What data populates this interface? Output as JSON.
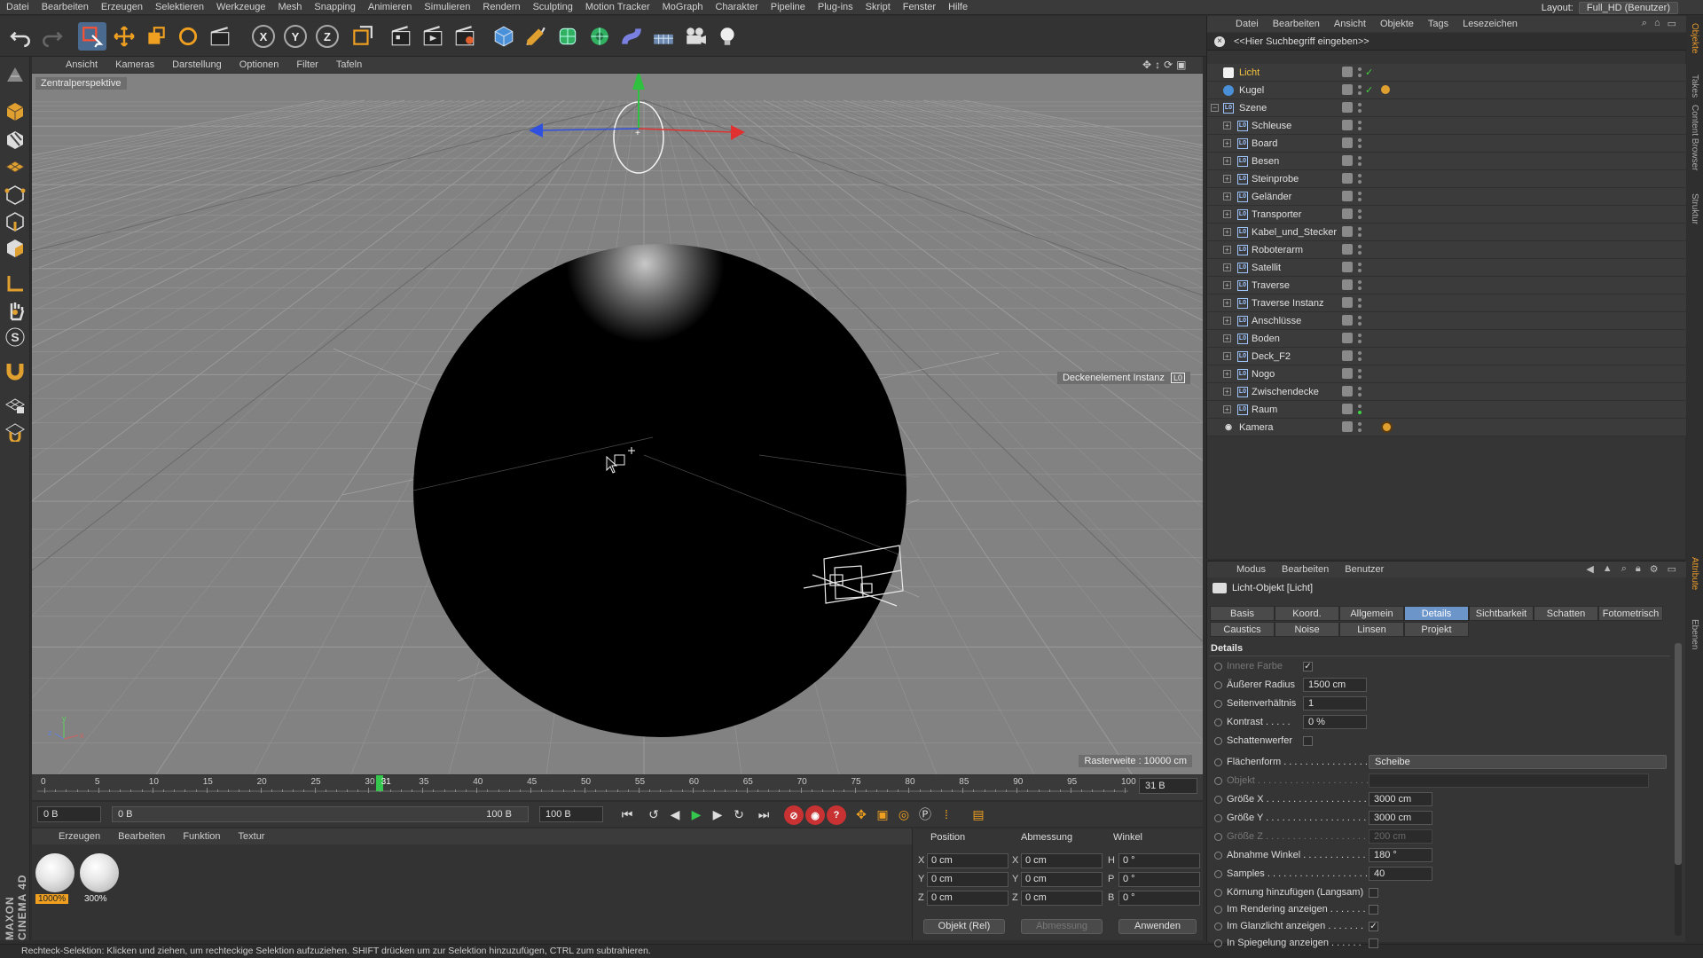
{
  "menubar": {
    "items": [
      "Datei",
      "Bearbeiten",
      "Erzeugen",
      "Selektieren",
      "Werkzeuge",
      "Mesh",
      "Snapping",
      "Animieren",
      "Simulieren",
      "Rendern",
      "Sculpting",
      "Motion Tracker",
      "MoGraph",
      "Charakter",
      "Pipeline",
      "Plug-ins",
      "Skript",
      "Fenster",
      "Hilfe"
    ],
    "layout_label": "Layout:",
    "layout_value": "Full_HD (Benutzer)"
  },
  "toolbar": {
    "axis_x": "X",
    "axis_y": "Y",
    "axis_z": "Z"
  },
  "viewport": {
    "menu": [
      "Ansicht",
      "Kameras",
      "Darstellung",
      "Optionen",
      "Filter",
      "Tafeln"
    ],
    "camera_label": "Zentralperspektive",
    "object_label": "Deckenelement Instanz",
    "grid_status": "Rasterweite : 10000 cm",
    "axis_x": "x",
    "axis_y": "y",
    "axis_z": "z"
  },
  "timeline": {
    "ticks": [
      "0",
      "5",
      "10",
      "15",
      "20",
      "25",
      "30",
      "31",
      "35",
      "40",
      "45",
      "50",
      "55",
      "60",
      "65",
      "70",
      "75",
      "80",
      "85",
      "90",
      "95",
      "100"
    ],
    "current_frame": 31,
    "end_field": "31 B"
  },
  "transport": {
    "start_field": "0 B",
    "range_start": "0 B",
    "range_end": "100 B",
    "end_field": "100 B"
  },
  "material_manager": {
    "menu": [
      "Erzeugen",
      "Bearbeiten",
      "Funktion",
      "Textur"
    ],
    "materials": [
      {
        "pct": "1000%"
      },
      {
        "pct": "300%"
      }
    ]
  },
  "coordinates": {
    "header_position": "Position",
    "header_size": "Abmessung",
    "header_angle": "Winkel",
    "rows": [
      {
        "axis": "X",
        "pos": "0 cm",
        "size_axis": "X",
        "size": "0 cm",
        "angle_axis": "H",
        "angle": "0 °"
      },
      {
        "axis": "Y",
        "pos": "0 cm",
        "size_axis": "Y",
        "size": "0 cm",
        "angle_axis": "P",
        "angle": "0 °"
      },
      {
        "axis": "Z",
        "pos": "0 cm",
        "size_axis": "Z",
        "size": "0 cm",
        "angle_axis": "B",
        "angle": "0 °"
      }
    ],
    "mode": "Objekt (Rel)",
    "size_mode": "Abmessung",
    "apply": "Anwenden"
  },
  "object_manager": {
    "menu": [
      "Datei",
      "Bearbeiten",
      "Ansicht",
      "Objekte",
      "Tags",
      "Lesezeichen"
    ],
    "search_placeholder": "<<Hier Suchbegriff eingeben>>",
    "objects": [
      {
        "name": "Licht",
        "type": "light",
        "selected": true
      },
      {
        "name": "Kugel",
        "type": "sphere"
      },
      {
        "name": "Szene",
        "type": "null"
      },
      {
        "name": "Schleuse",
        "type": "null",
        "child": true
      },
      {
        "name": "Board",
        "type": "null",
        "child": true
      },
      {
        "name": "Besen",
        "type": "null",
        "child": true
      },
      {
        "name": "Steinprobe",
        "type": "null",
        "child": true
      },
      {
        "name": "Geländer",
        "type": "null",
        "child": true
      },
      {
        "name": "Transporter",
        "type": "null",
        "child": true
      },
      {
        "name": "Kabel_und_Stecker",
        "type": "null",
        "child": true
      },
      {
        "name": "Roboterarm",
        "type": "null",
        "child": true
      },
      {
        "name": "Satellit",
        "type": "null",
        "child": true
      },
      {
        "name": "Traverse",
        "type": "null",
        "child": true
      },
      {
        "name": "Traverse Instanz",
        "type": "null",
        "child": true
      },
      {
        "name": "Anschlüsse",
        "type": "null",
        "child": true
      },
      {
        "name": "Boden",
        "type": "null",
        "child": true
      },
      {
        "name": "Deck_F2",
        "type": "null",
        "child": true
      },
      {
        "name": "Nogo",
        "type": "null",
        "child": true
      },
      {
        "name": "Zwischendecke",
        "type": "null",
        "child": true
      },
      {
        "name": "Raum",
        "type": "null",
        "child": true
      },
      {
        "name": "Kamera",
        "type": "camera"
      }
    ]
  },
  "attribute_manager": {
    "menu": [
      "Modus",
      "Bearbeiten",
      "Benutzer"
    ],
    "title": "Licht-Objekt [Licht]",
    "tabs_row1": [
      "Basis",
      "Koord.",
      "Allgemein",
      "Details",
      "Sichtbarkeit",
      "Schatten",
      "Fotometrisch"
    ],
    "tabs_row2": [
      "Caustics",
      "Noise",
      "Linsen",
      "Projekt"
    ],
    "active_tab": "Details",
    "section": "Details",
    "rows": [
      {
        "label": "Innere Farbe",
        "kind": "check",
        "value": "✓",
        "dim": true
      },
      {
        "label": "Äußerer Radius",
        "kind": "num",
        "value": "1500 cm"
      },
      {
        "label": "Seitenverhältnis",
        "kind": "num",
        "value": "1"
      },
      {
        "label": "Kontrast . . . . .",
        "kind": "num",
        "value": "0 %"
      },
      {
        "label": "Schattenwerfer",
        "kind": "check",
        "value": ""
      },
      {
        "label": "Flächenform . . . . . . . . . . . . . . . .",
        "kind": "drop",
        "value": "Scheibe"
      },
      {
        "label": "Objekt . . . . . . . . . . . . . . . . . . . . .",
        "kind": "link",
        "value": "",
        "dim": true
      },
      {
        "label": "Größe X . . . . . . . . . . . . . . . . . . .",
        "kind": "num2",
        "value": "3000 cm"
      },
      {
        "label": "Größe Y . . . . . . . . . . . . . . . . . . .",
        "kind": "num2",
        "value": "3000 cm"
      },
      {
        "label": "Größe Z . . . . . . . . . . . . . . . . . . .",
        "kind": "num2",
        "value": "200 cm",
        "dim": true
      },
      {
        "label": "Abnahme Winkel . . . . . . . . . . . . .",
        "kind": "num2",
        "value": "180 °"
      },
      {
        "label": "Samples . . . . . . . . . . . . . . . . . . .",
        "kind": "num2",
        "value": "40"
      },
      {
        "label": "Körnung hinzufügen (Langsam)",
        "kind": "check2",
        "value": ""
      },
      {
        "label": "Im Rendering anzeigen . . . . . . .",
        "kind": "check2",
        "value": ""
      },
      {
        "label": "Im Glanzlicht anzeigen . . . . . . .",
        "kind": "check2",
        "value": "✓"
      },
      {
        "label": "In Spiegelung anzeigen . . . . . .",
        "kind": "check2",
        "value": ""
      }
    ]
  },
  "right_tabs": [
    "Objekte",
    "Takes",
    "Content Browser",
    "Struktur",
    "Attribute",
    "Ebenen"
  ],
  "branding": "MAXON CINEMA 4D",
  "statusbar": "Rechteck-Selektion: Klicken und ziehen, um rechteckige Selektion aufzuziehen. SHIFT drücken um zur Selektion hinzuzufügen, CTRL zum subtrahieren.",
  "colors": {
    "accent": "#6c95c9",
    "selected_object": "#f0c040",
    "timeline_cursor": "#35c64e",
    "axis_x": "#e03030",
    "axis_y": "#30c040",
    "axis_z": "#3050e0"
  }
}
